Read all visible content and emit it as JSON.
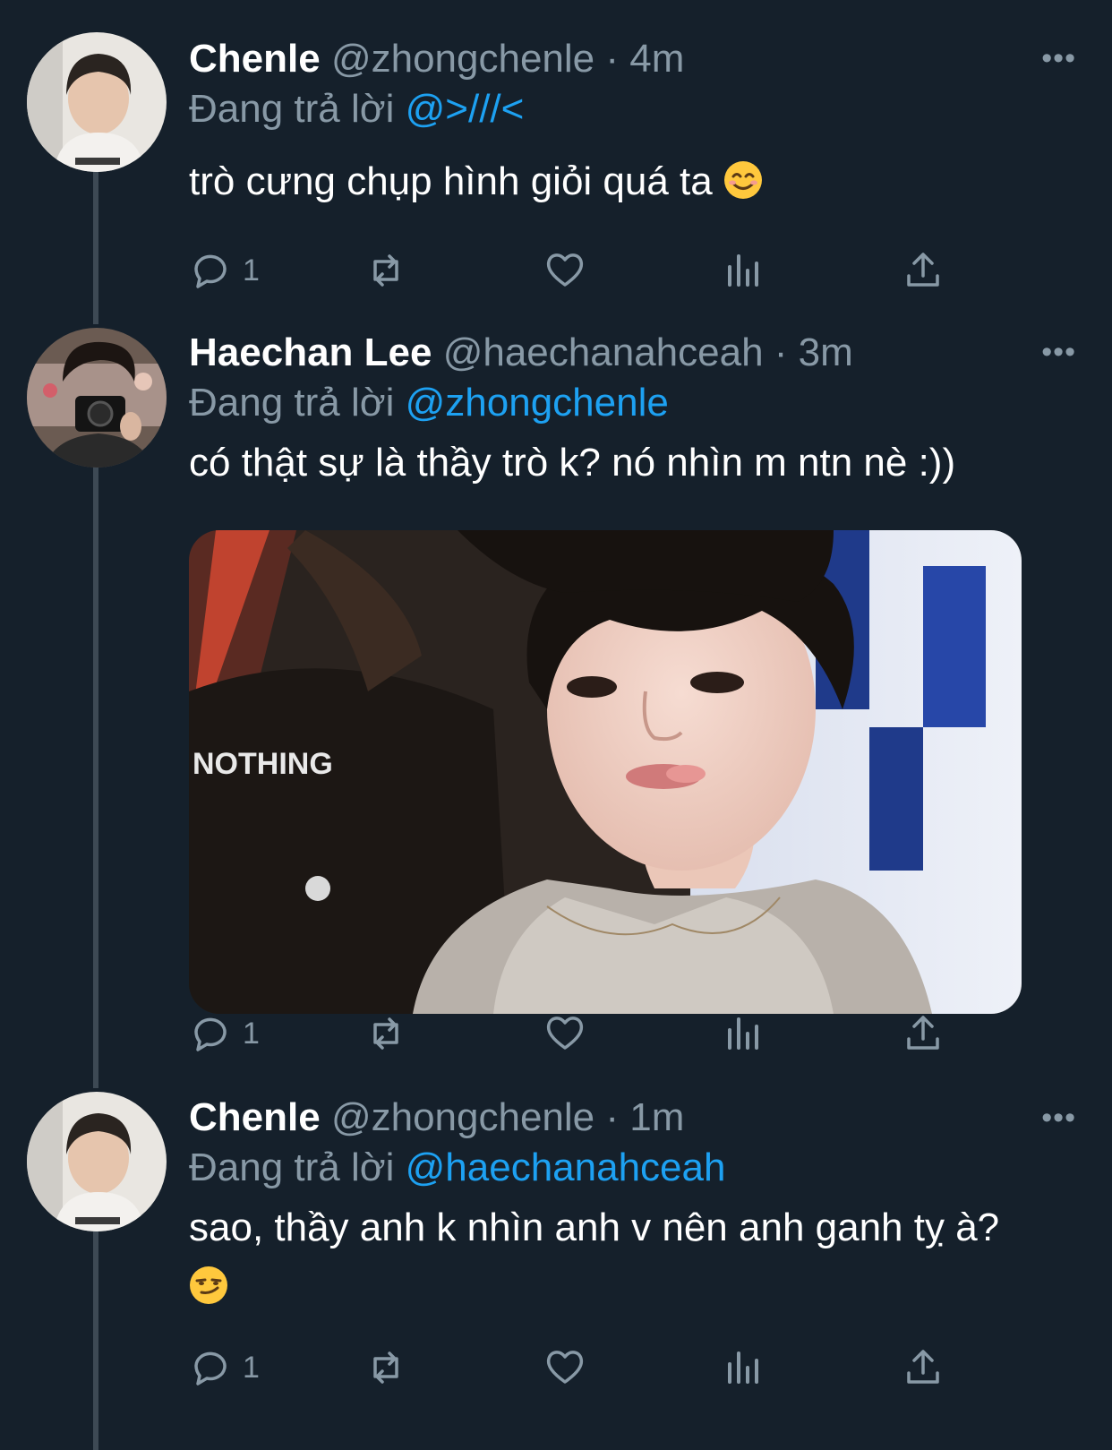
{
  "colors": {
    "background": "#15202b",
    "text": "#ffffff",
    "muted": "#8899a6",
    "mention": "#1da1f2",
    "thread_line": "#3d4954"
  },
  "tweets": [
    {
      "name": "Chenle",
      "handle": "@zhongchenle",
      "time": "· 4m",
      "reply_prefix": "Đang trả lời",
      "reply_to": "@>///<",
      "text": "trò cưng chụp hình giỏi quá ta",
      "emoji": "smiling-face-icon",
      "reply_count": "1"
    },
    {
      "name": "Haechan Lee",
      "handle": "@haechanahceah",
      "time": "· 3m",
      "reply_prefix": "Đang trả lời",
      "reply_to": "@zhongchenle",
      "text": "có thật sự là thầy trò k? nó nhìn m ntn nè :))",
      "media_text": "NOTHING",
      "reply_count": "1"
    },
    {
      "name": "Chenle",
      "handle": "@zhongchenle",
      "time": "· 1m",
      "reply_prefix": "Đang trả lời",
      "reply_to": "@haechanahceah",
      "text": "sao, thầy anh k nhìn anh v nên anh ganh tỵ à?",
      "emoji": "smirking-face-icon",
      "reply_count": "1"
    }
  ]
}
